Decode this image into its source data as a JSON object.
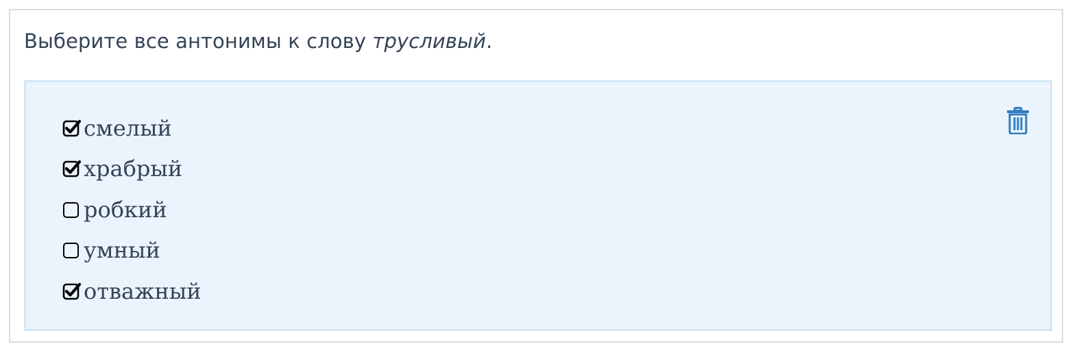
{
  "question": {
    "prefix": "Выберите все антонимы к слову ",
    "word": "трусливый",
    "suffix": "."
  },
  "options": [
    {
      "label": "смелый",
      "checked": true
    },
    {
      "label": "храбрый",
      "checked": true
    },
    {
      "label": "робкий",
      "checked": false
    },
    {
      "label": "умный",
      "checked": false
    },
    {
      "label": "отважный",
      "checked": true
    }
  ],
  "delete_icon": "trash-icon",
  "colors": {
    "text": "#344357",
    "answer_bg": "#ebf4fc",
    "answer_border": "#d2e6f6",
    "trash": "#2f7ec1"
  }
}
